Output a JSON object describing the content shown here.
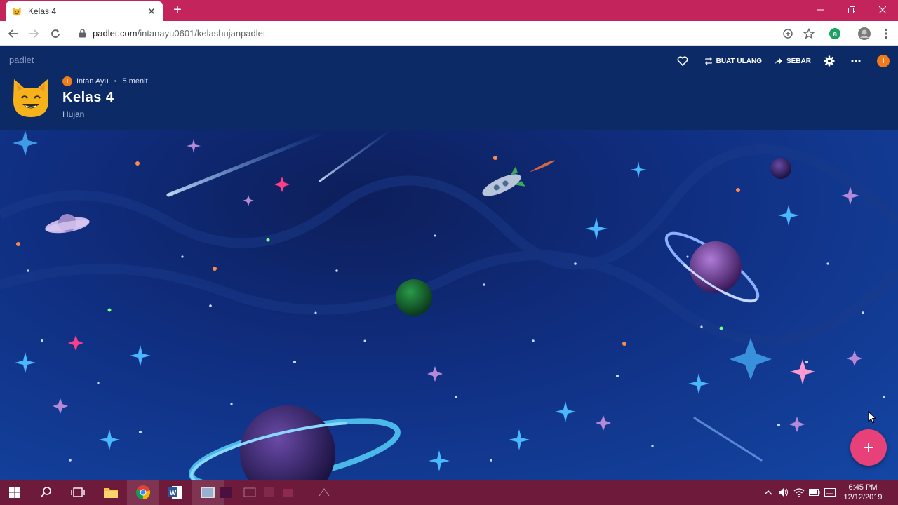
{
  "browser": {
    "tab_title": "Kelas 4",
    "url_host": "padlet.com",
    "url_path": "/intanayu0601/kelashujanpadlet"
  },
  "padlet": {
    "logo": "padlet",
    "author": "Intan Ayu",
    "author_initial": "I",
    "time_ago": "5 menit",
    "title": "Kelas 4",
    "subtitle": "Hujan",
    "actions": {
      "remake": "BUAT ULANG",
      "share": "SEBAR"
    }
  },
  "taskbar": {
    "time": "6:45 PM",
    "date": "12/12/2019"
  },
  "colors": {
    "tabstrip": "#c4245c",
    "header": "#0c2a66",
    "fab": "#e8417a",
    "taskbar": "#6e1a3a"
  }
}
